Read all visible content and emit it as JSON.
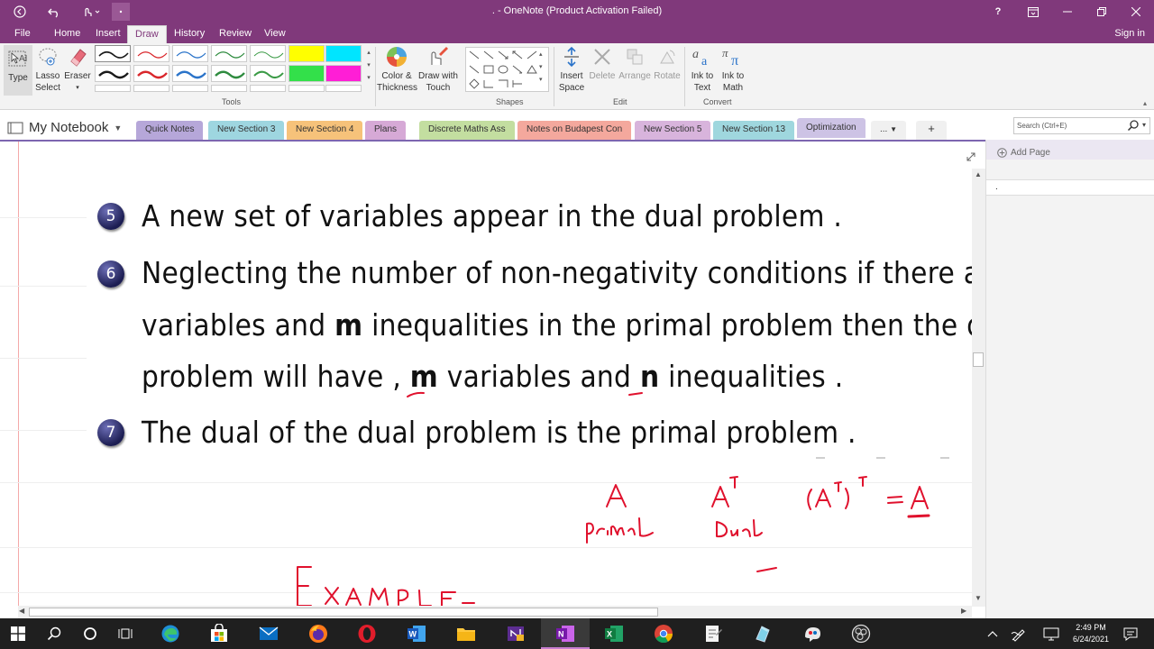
{
  "titlebar": {
    "title": ". - OneNote (Product Activation Failed)",
    "help": "?",
    "accent": "#80397b"
  },
  "menu": {
    "tabs": [
      "File",
      "Home",
      "Insert",
      "Draw",
      "History",
      "Review",
      "View"
    ],
    "active": "Draw",
    "signin": "Sign in"
  },
  "ribbon": {
    "tools": {
      "type": "Type",
      "lasso_line1": "Lasso",
      "lasso_line2": "Select",
      "eraser": "Eraser",
      "group_label": "Tools",
      "pen_colors": [
        "#1a1a1a",
        "#d9262b",
        "#2a73c9",
        "#2e8b3e",
        "#3a9a45",
        "#ffff00",
        "#00e5ff",
        "#1a1a1a",
        "#d9262b",
        "#2a73c9",
        "#2e8b3e",
        "#3a9a45",
        "#33e04a",
        "#ff1ed6"
      ]
    },
    "color_thickness_line1": "Color &",
    "color_thickness_line2": "Thickness",
    "draw_touch_line1": "Draw with",
    "draw_touch_line2": "Touch",
    "shapes_label": "Shapes",
    "edit": {
      "insert_line1": "Insert",
      "insert_line2": "Space",
      "delete": "Delete",
      "arrange": "Arrange",
      "rotate": "Rotate",
      "group_label": "Edit"
    },
    "convert": {
      "ink_text_line1": "Ink to",
      "ink_text_line2": "Text",
      "ink_math_line1": "Ink to",
      "ink_math_line2": "Math",
      "group_label": "Convert"
    }
  },
  "notebook": {
    "name": "My Notebook",
    "sections": [
      {
        "label": "Quick Notes",
        "color": "#b6a7d9"
      },
      {
        "label": "New Section 3",
        "color": "#9ed6e0"
      },
      {
        "label": "New Section 4",
        "color": "#f6c27a"
      },
      {
        "label": "Plans",
        "color": "#d6a9d6"
      },
      {
        "label": "Discrete Maths Ass",
        "color": "#c3dea0"
      },
      {
        "label": "Notes on Budapest Con",
        "color": "#f4a89d"
      },
      {
        "label": "New Section 5",
        "color": "#d8b4dc"
      },
      {
        "label": "New Section 13",
        "color": "#9fd7de"
      },
      {
        "label": "Optimization",
        "color": "#cfc6e6"
      }
    ],
    "more": "...",
    "add": "+",
    "search_placeholder": "Search (Ctrl+E)"
  },
  "pages_pane": {
    "add_page": "Add Page",
    "current_page": "."
  },
  "content": {
    "item5_number": "5",
    "item5_text": "A new set of variables appear in the dual problem .",
    "item6_number": "6",
    "item6_line1": "Neglecting the number of non-negativity conditions if there are",
    "item6_line2_a": "variables and ",
    "item6_line2_m": "m",
    "item6_line2_b": " inequalities in the primal problem then the dual",
    "item6_line3_a": "problem will have , ",
    "item6_line3_m": "m",
    "item6_line3_b": " variables and ",
    "item6_line3_n": "n",
    "item6_line3_c": " inequalities .",
    "item7_number": "7",
    "item7_text": "The dual of the dual problem is the primal problem .",
    "ink_color": "#e0112d"
  },
  "taskbar": {
    "time": "2:49 PM",
    "date": "6/24/2021"
  }
}
